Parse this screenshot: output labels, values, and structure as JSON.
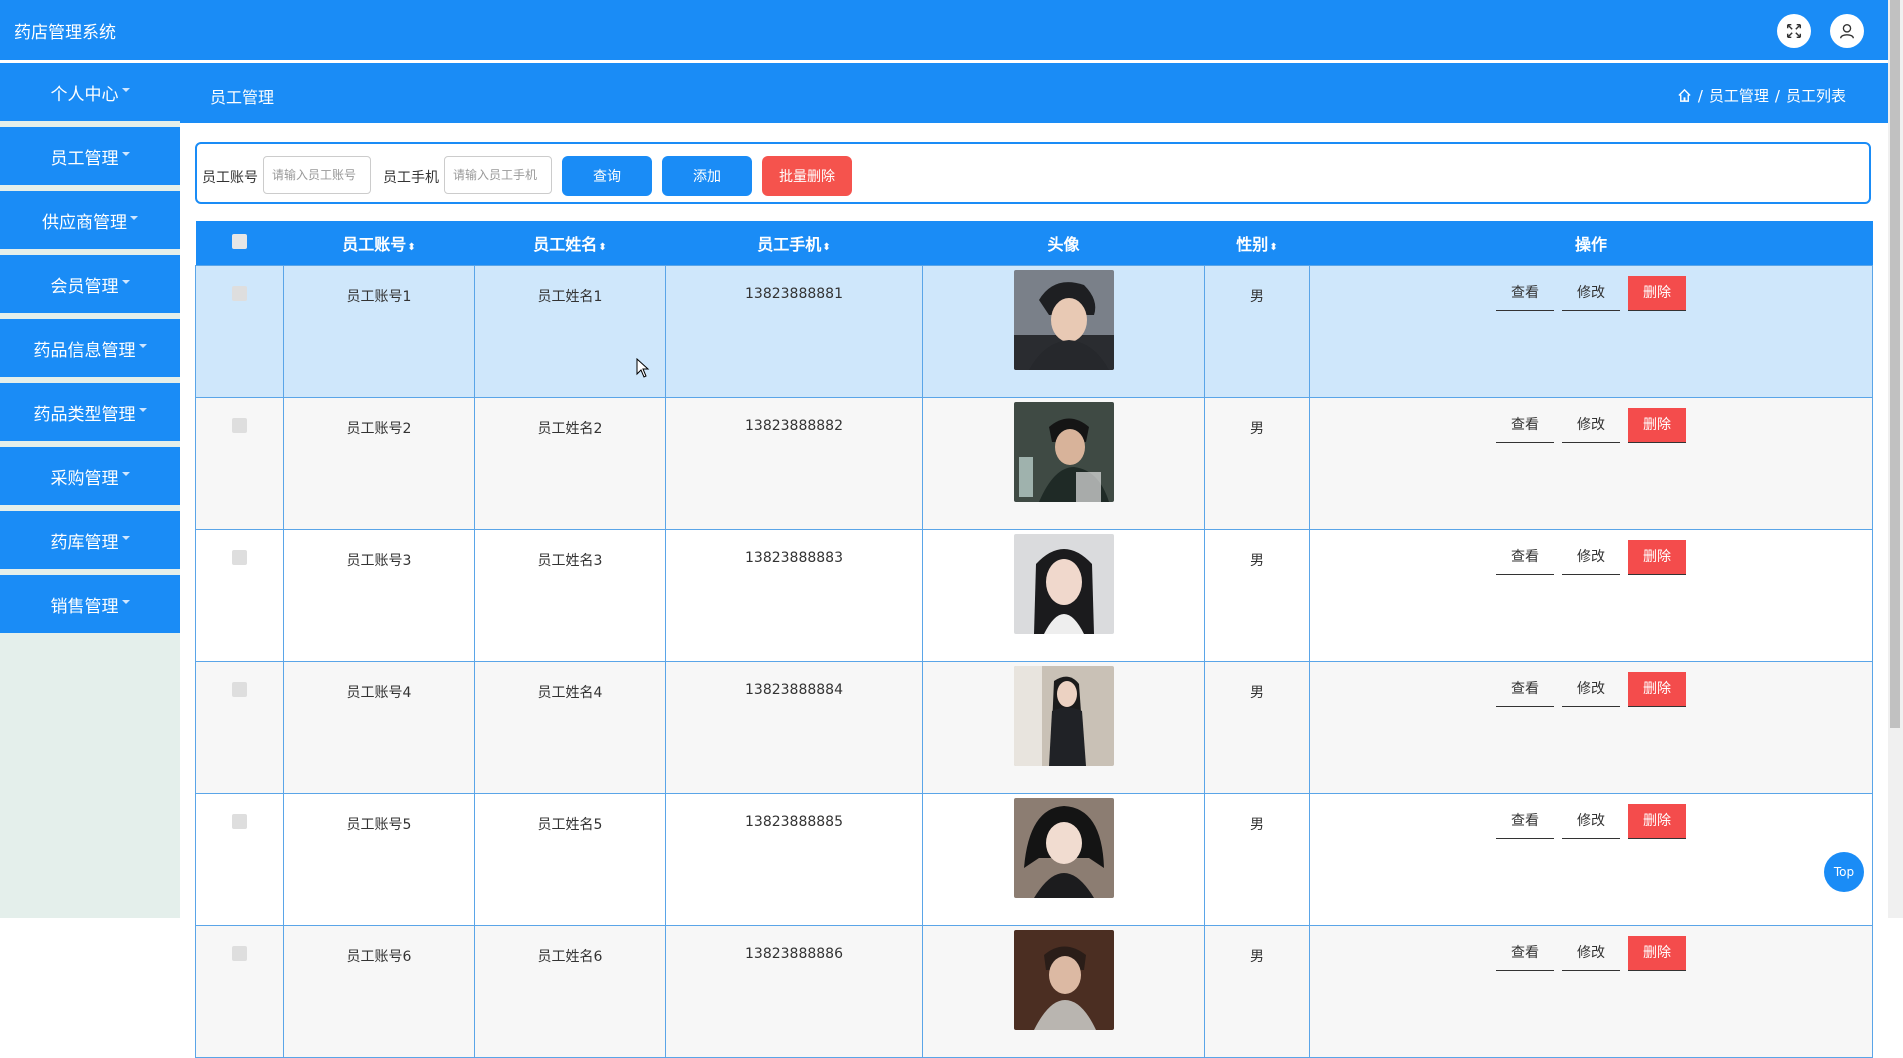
{
  "app": {
    "title": "药店管理系统"
  },
  "sidebar": {
    "items": [
      {
        "label": "个人中心"
      },
      {
        "label": "员工管理"
      },
      {
        "label": "供应商管理"
      },
      {
        "label": "会员管理"
      },
      {
        "label": "药品信息管理"
      },
      {
        "label": "药品类型管理"
      },
      {
        "label": "采购管理"
      },
      {
        "label": "药库管理"
      },
      {
        "label": "销售管理"
      }
    ]
  },
  "header": {
    "title": "员工管理",
    "breadcrumb": [
      "员工管理",
      "员工列表"
    ]
  },
  "search": {
    "account_label": "员工账号",
    "account_placeholder": "请输入员工账号",
    "phone_label": "员工手机",
    "phone_placeholder": "请输入员工手机",
    "query_label": "查询",
    "add_label": "添加",
    "batch_delete_label": "批量删除"
  },
  "table": {
    "columns": [
      "员工账号",
      "员工姓名",
      "员工手机",
      "头像",
      "性别",
      "操作"
    ],
    "actions": {
      "view": "查看",
      "edit": "修改",
      "delete": "删除"
    },
    "rows": [
      {
        "account": "员工账号1",
        "name": "员工姓名1",
        "phone": "13823888881",
        "gender": "男"
      },
      {
        "account": "员工账号2",
        "name": "员工姓名2",
        "phone": "13823888882",
        "gender": "男"
      },
      {
        "account": "员工账号3",
        "name": "员工姓名3",
        "phone": "13823888883",
        "gender": "男"
      },
      {
        "account": "员工账号4",
        "name": "员工姓名4",
        "phone": "13823888884",
        "gender": "男"
      },
      {
        "account": "员工账号5",
        "name": "员工姓名5",
        "phone": "13823888885",
        "gender": "男"
      },
      {
        "account": "员工账号6",
        "name": "员工姓名6",
        "phone": "13823888886",
        "gender": "男"
      }
    ]
  },
  "misc": {
    "top_label": "Top"
  },
  "colors": {
    "primary": "#1a8cf6",
    "danger": "#f44c4c",
    "batch_delete": "#f5534d",
    "row_selected": "#cfe7fb",
    "sidebar_bg": "#e4efeb"
  },
  "icons": {
    "fullscreen": "fullscreen-icon",
    "user": "user-icon",
    "home": "home-icon",
    "sort": "sort-icon"
  }
}
